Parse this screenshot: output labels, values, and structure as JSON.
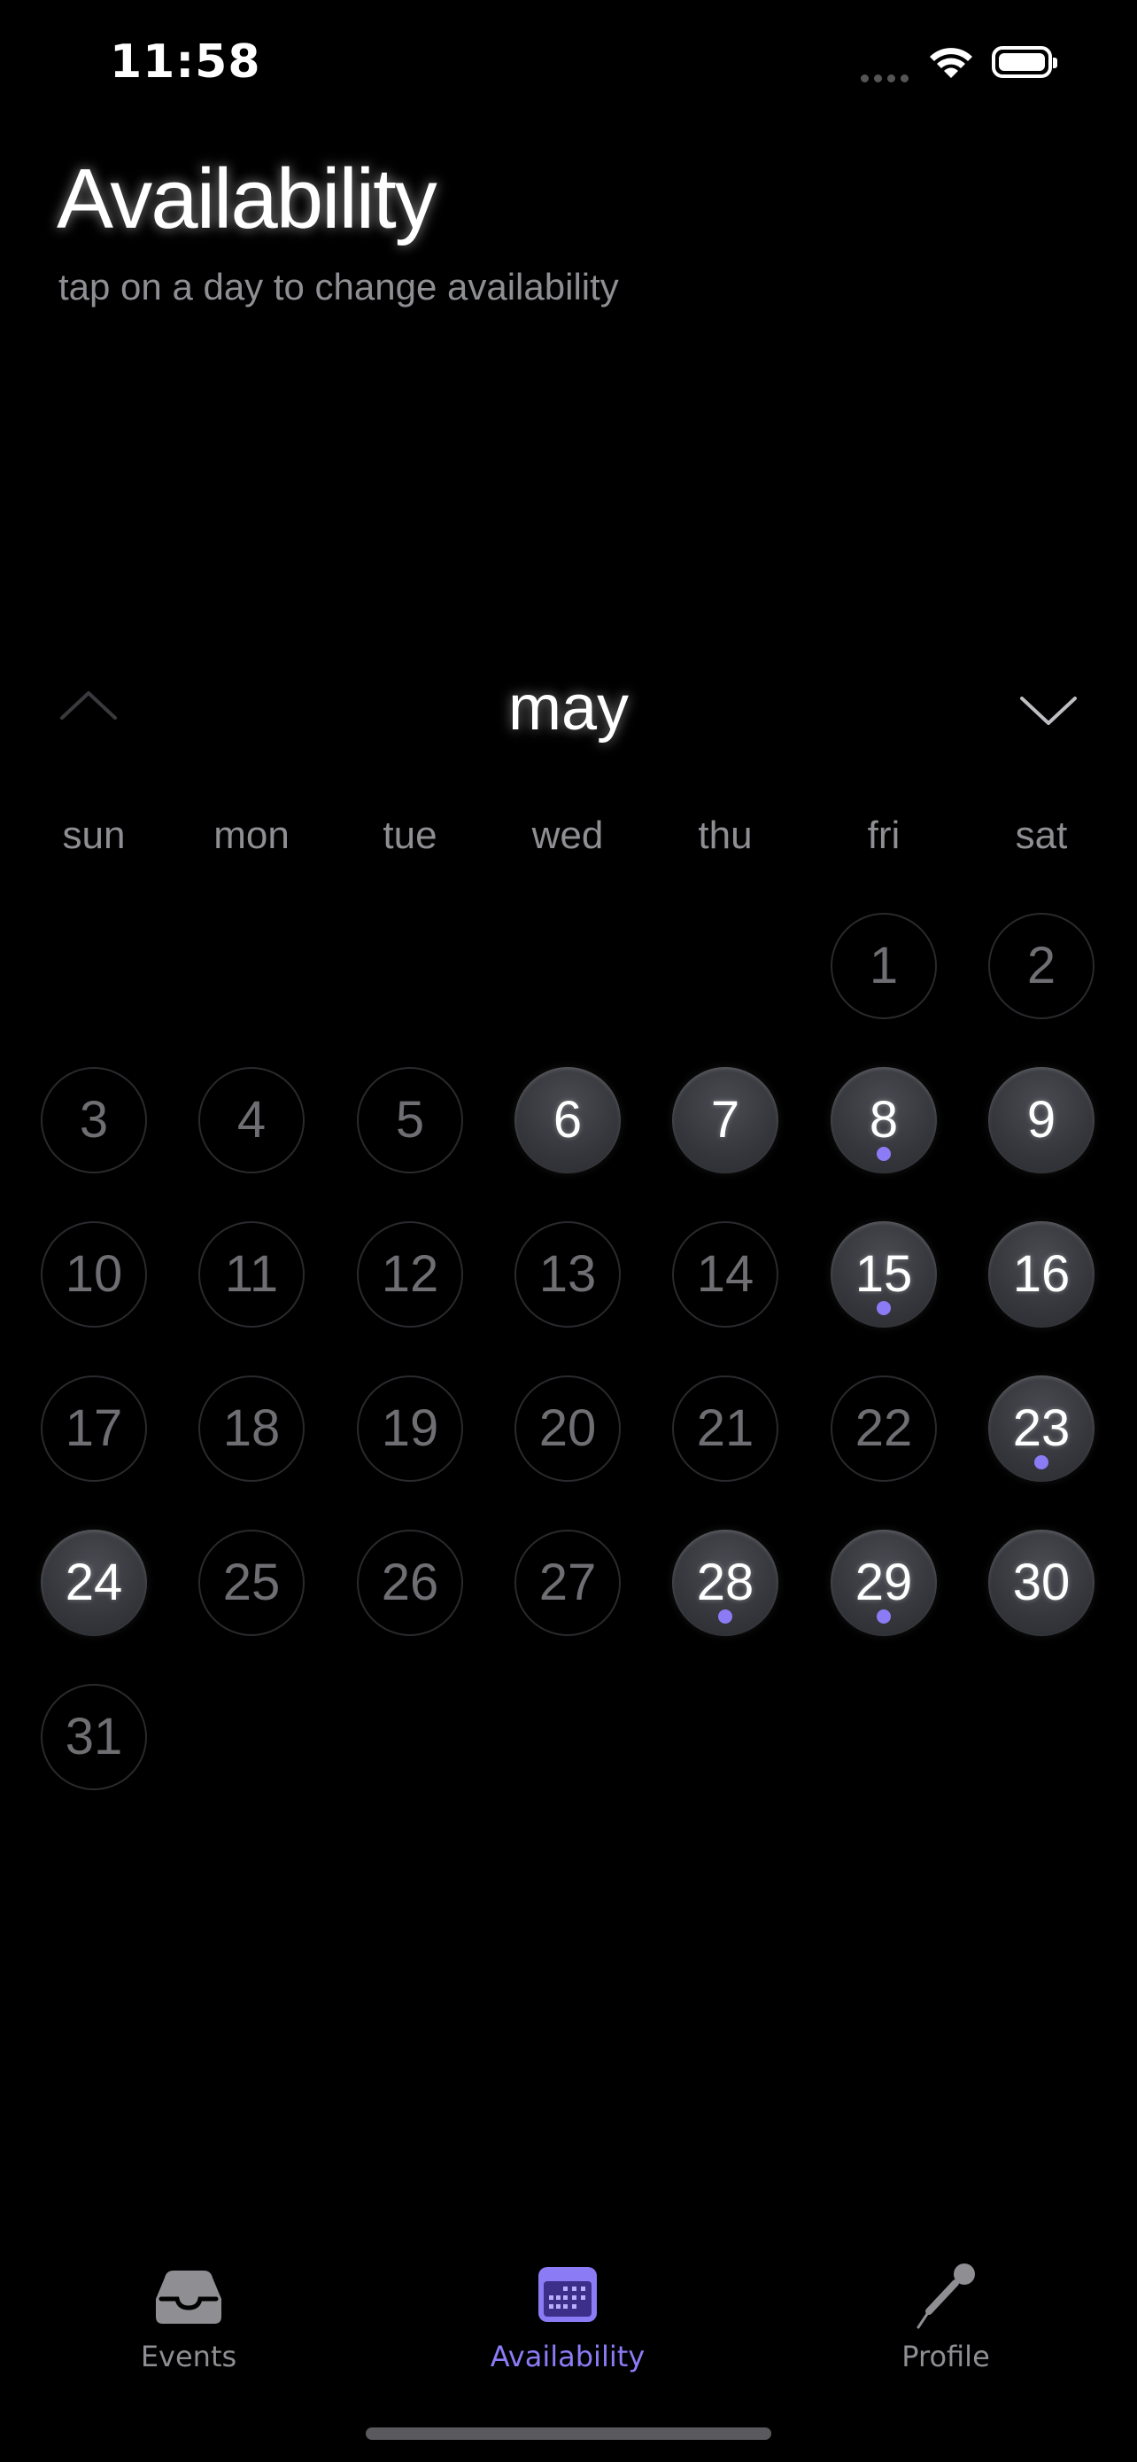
{
  "status_bar": {
    "time": "11:58"
  },
  "header": {
    "title": "Availability",
    "subtitle": "tap on a day to change availability"
  },
  "calendar": {
    "month": "may",
    "weekdays": [
      "sun",
      "mon",
      "tue",
      "wed",
      "thu",
      "fri",
      "sat"
    ],
    "first_weekday_index": 5,
    "days_in_month": 31,
    "available_days": [
      6,
      7,
      8,
      9,
      15,
      16,
      23,
      24,
      28,
      29,
      30
    ],
    "marked_days": [
      8,
      15,
      23,
      28,
      29
    ],
    "accent_color": "#8b7cf6"
  },
  "tab_bar": {
    "tabs": [
      {
        "label": "Events",
        "icon": "inbox-tray-icon",
        "active": false
      },
      {
        "label": "Availability",
        "icon": "calendar-icon",
        "active": true
      },
      {
        "label": "Profile",
        "icon": "microphone-icon",
        "active": false
      }
    ]
  }
}
